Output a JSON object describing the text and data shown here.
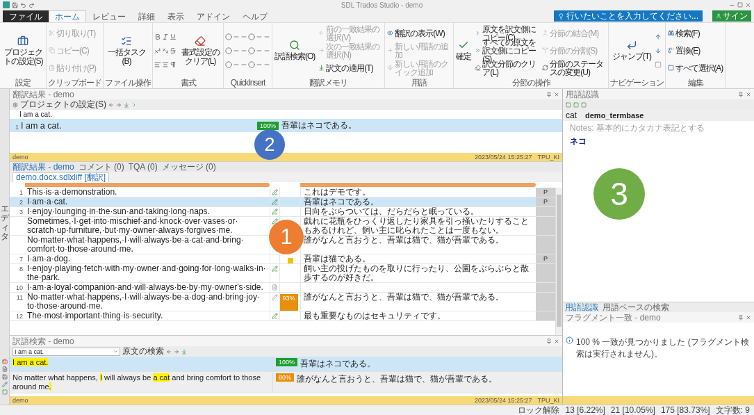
{
  "title_bar": {
    "title": "SDL Trados Studio - demo"
  },
  "menu_tabs": [
    {
      "label": "ファイル",
      "kind": "file",
      "selected": false
    },
    {
      "label": "ホーム",
      "kind": "tab",
      "selected": true
    },
    {
      "label": "レビュー",
      "kind": "tab",
      "selected": false
    },
    {
      "label": "詳細",
      "kind": "tab",
      "selected": false
    },
    {
      "label": "表示",
      "kind": "tab",
      "selected": false
    },
    {
      "label": "アドイン",
      "kind": "tab",
      "selected": false
    },
    {
      "label": "ヘルプ",
      "kind": "tab",
      "selected": false
    }
  ],
  "tell_me": {
    "placeholder": "行いたいことを入力してください..."
  },
  "sign_in": {
    "label": "サイン"
  },
  "ribbon": {
    "groups": [
      {
        "label": "設定",
        "kind": "plain",
        "items": [
          {
            "label": "プロジェクトの設定(S)",
            "kind": "large",
            "disabled": false
          }
        ]
      },
      {
        "label": "クリップボード",
        "kind": "plain",
        "items": [
          {
            "label": "切り取り(T)",
            "kind": "small",
            "disabled": true
          },
          {
            "label": "コピー(C)",
            "kind": "small",
            "disabled": true
          },
          {
            "label": "貼り付け(P)",
            "kind": "small",
            "disabled": true
          }
        ]
      },
      {
        "label": "ファイル操作",
        "kind": "plain",
        "items": [
          {
            "label": "一括タスク(B)",
            "kind": "large",
            "disabled": false
          }
        ]
      },
      {
        "label": "書式",
        "kind": "format",
        "items": [
          {
            "label": "書式設定のクリア(L)",
            "kind": "large",
            "disabled": false
          }
        ]
      },
      {
        "label": "QuickInsert",
        "kind": "quickinsert"
      },
      {
        "label": "翻訳メモリ",
        "kind": "plain",
        "items": [
          {
            "label": "訳語検索(O)",
            "kind": "large",
            "disabled": false
          },
          {
            "label": "前の一致結果の選択(V)",
            "kind": "small",
            "disabled": true
          },
          {
            "label": "次の一致結果の選択(N)",
            "kind": "small",
            "disabled": true
          },
          {
            "label": "訳文の適用(T)",
            "kind": "small",
            "disabled": false
          }
        ]
      },
      {
        "label": "用語",
        "kind": "plain",
        "items": [
          {
            "label": "翻訳の表示(W)",
            "kind": "small",
            "disabled": false
          },
          {
            "label": "新しい用語の追加",
            "kind": "small",
            "disabled": true
          },
          {
            "label": "新しい用語のクイック追加",
            "kind": "small",
            "disabled": true
          }
        ]
      },
      {
        "label": "分節の操作",
        "kind": "plain",
        "items": [
          {
            "label": "確定",
            "kind": "large",
            "disabled": false
          },
          {
            "label": "原文を訳文側にコピー(C)",
            "kind": "small",
            "disabled": false
          },
          {
            "label": "すべての原文を訳文側にコピー(S)",
            "kind": "small",
            "disabled": false
          },
          {
            "label": "訳文分節のクリア(L)",
            "kind": "small",
            "disabled": false
          },
          {
            "label": "分節の結合(M)",
            "kind": "small",
            "disabled": true
          },
          {
            "label": "分節の分割(S)",
            "kind": "small",
            "disabled": true
          },
          {
            "label": "分節のステータスの変更(U)",
            "kind": "small",
            "disabled": false
          }
        ]
      },
      {
        "label": "ナビゲーション",
        "kind": "navigation",
        "items": [
          {
            "label": "ジャンプ(T)",
            "kind": "large",
            "disabled": false
          }
        ]
      },
      {
        "label": "編集",
        "kind": "plain",
        "items": [
          {
            "label": "検索(F)",
            "kind": "small",
            "disabled": false
          },
          {
            "label": "置換(E)",
            "kind": "small",
            "disabled": false
          },
          {
            "label": "すべて選択(A)",
            "kind": "small",
            "disabled": false
          }
        ]
      }
    ]
  },
  "side_label": "エディタ",
  "translation_results": {
    "title": "翻訳結果 - demo",
    "toolbar_label": "プロジェクトの設定(S)",
    "source": "I am a cat.",
    "rows": [
      {
        "number": "1",
        "source": "I am a cat.",
        "match": {
          "label": "100%",
          "color": "#1f9e2c"
        },
        "target": "吾輩はネコである。",
        "selected": true
      }
    ],
    "footer": {
      "left": "demo",
      "date": "2023/05/24 15:25:27",
      "user": "TPU_KI"
    },
    "marker": {
      "label": "2",
      "color": "#4472c4"
    }
  },
  "bottom_tabs": [
    {
      "label": "翻訳結果 - demo",
      "selected": true
    },
    {
      "label": "コメント (0)",
      "selected": false
    },
    {
      "label": "TQA (0)",
      "selected": false
    },
    {
      "label": "メッセージ (0)",
      "selected": false
    }
  ],
  "editor": {
    "file_tab": "demo.docx.sdlxliff [翻訳]",
    "rows": [
      {
        "number": "1",
        "source": "This·is·a·demonstration.",
        "kind": "confirmed",
        "target": "これはデモです。",
        "flag": "P",
        "selected": false
      },
      {
        "number": "2",
        "source": "I·am·a·cat.",
        "kind": "confirmed",
        "target": "吾輩はネコである。",
        "flag": "P",
        "selected": true
      },
      {
        "number": "3",
        "source": "I·enjoy·lounging·in·the·sun·and·taking·long·naps.",
        "kind": "confirmed",
        "target": "日向をぶらついては、だらだらと眠っている。",
        "selected": false
      },
      {
        "source": "Sometimes,·I·get·into·mischief·and·knock·over·vases·or·scratch·up·furniture,·but·my·owner·always·forgives·me.",
        "kind": "confirmed",
        "target": "戯れに花瓶をひっくり返したり家具を引っ掻いたりすることもあるけれど、飼い主に叱られたことは一度もない。",
        "selected": false
      },
      {
        "source": "No·matter·what·happens,·I·will·always·be·a·cat·and·bring·comfort·to·those·around·me.",
        "kind": "plain",
        "target": "誰がなんと言おうと、吾輩は猫で、猫が吾輩である。",
        "selected": false
      },
      {
        "number": "7",
        "source": "I·am·a·dog.",
        "kind": "plain",
        "match": {
          "kind": "context",
          "color": "#f2c200"
        },
        "target": "吾輩は猫である。",
        "flag": "P",
        "selected": false
      },
      {
        "number": "8",
        "source": "I·enjoy·playing·fetch·with·my·owner·and·going·for·long·walks·in·the·park.",
        "kind": "confirmed",
        "target": "飼い主の投げたものを取りに行ったり、公園をぶらぶらと散歩するのが好きだ。",
        "selected": false
      },
      {
        "number": "10",
        "source": "I·am·a·loyal·companion·and·will·always·be·by·my·owner's·side.",
        "kind": "empty",
        "selected": false
      },
      {
        "number": "11",
        "source": "No·matter·what·happens,·I·will·always·be·a·dog·and·bring·joy·to·those·around·me.",
        "kind": "draft",
        "match": {
          "kind": "percent",
          "label": "93%",
          "color": "#e8900c"
        },
        "target": "誰がなんと言おうと、吾輩は猫で、猫が吾輩である。",
        "selected": false
      },
      {
        "number": "12",
        "source": "The·most·important·thing·is·security.",
        "kind": "confirmed",
        "target": "最も重要なものはセキュリティです。",
        "selected": false
      }
    ],
    "marker": {
      "label": "1",
      "color": "#ed7d31"
    }
  },
  "term_search": {
    "title": "訳語検索 - demo",
    "query": "I am a cat.",
    "search_label": "原文の検索",
    "rows": [
      {
        "source": [
          {
            "text": "I ",
            "highlight": true
          },
          {
            "text": "am ",
            "highlight": true
          },
          {
            "text": "a ",
            "highlight": true
          },
          {
            "text": "cat.",
            "highlight": true
          }
        ],
        "match": {
          "label": "100%",
          "color": "#1f9e2c"
        },
        "target": "吾輩はネコである。",
        "selected": true
      },
      {
        "source": [
          {
            "text": "No matter what happens, ",
            "highlight": false
          },
          {
            "text": "I",
            "highlight": true
          },
          {
            "text": " will always be ",
            "highlight": false
          },
          {
            "text": "a cat",
            "highlight": true
          },
          {
            "text": " and bring comfort to those around me",
            "highlight": false
          },
          {
            "text": ".",
            "highlight": true
          }
        ],
        "match": {
          "label": "80%",
          "color": "#e8900c"
        },
        "target": "誰がなんと言おうと、吾輩は猫で、猫が吾輩である。",
        "selected": false
      }
    ],
    "footer": {
      "left": "demo",
      "date": "2023/05/24 15:25:27",
      "user": "TPU_KI"
    }
  },
  "term_recognition": {
    "title": "用語認識",
    "term": "cat",
    "termbase": "demo_termbase",
    "notes": "Notes: 基本的にカタカナ表記とする",
    "translation": "ネコ",
    "marker": {
      "label": "3",
      "color": "#70ad47"
    }
  },
  "right_tabs": [
    {
      "label": "用語認識",
      "selected": true
    },
    {
      "label": "用語ベースの検索",
      "selected": false
    }
  ],
  "fragment_match": {
    "title": "フラグメント一致 - demo",
    "message": "100 % 一致が見つかりました (フラグメント検索は実行されません)。"
  },
  "status_bar": [
    "ロック解除",
    "13 [6.22%]",
    "21 [10.05%]",
    "175 [83.73%]",
    "文字数: 9"
  ]
}
